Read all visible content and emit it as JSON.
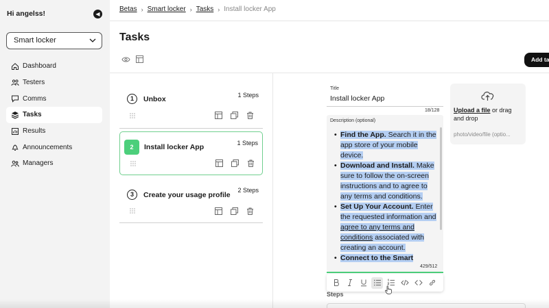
{
  "sidebar": {
    "greeting": "Hi angelss!",
    "project": "Smart locker",
    "items": [
      {
        "label": "Dashboard",
        "icon": "home-icon"
      },
      {
        "label": "Testers",
        "icon": "users-icon"
      },
      {
        "label": "Comms",
        "icon": "chat-icon"
      },
      {
        "label": "Tasks",
        "icon": "layers-icon",
        "active": true
      },
      {
        "label": "Results",
        "icon": "chart-icon"
      },
      {
        "label": "Announcements",
        "icon": "bell-icon"
      },
      {
        "label": "Managers",
        "icon": "managers-icon"
      }
    ]
  },
  "breadcrumb": [
    "Betas",
    "Smart locker",
    "Tasks",
    "Install locker App"
  ],
  "page_title": "Tasks",
  "add_button": "Add task",
  "tasks": [
    {
      "num": "1",
      "name": "Unbox",
      "steps": "1 Steps"
    },
    {
      "num": "2",
      "name": "Install locker App",
      "steps": "1 Steps",
      "selected": true
    },
    {
      "num": "3",
      "name": "Create your usage profile",
      "steps": "2 Steps"
    }
  ],
  "editor": {
    "title_label": "Title",
    "title_value": "Install locker App",
    "title_count": "18/128",
    "desc_label": "Description (optional)",
    "desc": {
      "b1_bold": "Find the App.",
      "b1_text": " Search it in the app store of your mobile device.",
      "b2_bold": "Download and Install.",
      "b2_text": " Make sure to follow the on-screen instructions and to agree to any terms and conditions.",
      "b3_bold": "Set Up Your Account.",
      "b3_text1": " Enter the requested information and ",
      "b3_link": "agree to any terms and conditions",
      "b3_text2": " associated with creating an account.",
      "b4_bold": "Connect to the Smart"
    },
    "desc_count": "429/512",
    "steps_label": "Steps"
  },
  "upload": {
    "link": "Upload a file",
    "text": " or drag and drop",
    "hint": "photo/video/file (optio..."
  },
  "colors": {
    "accent": "#4ccf7b",
    "selection": "#b4cef2",
    "dark": "#111111"
  }
}
